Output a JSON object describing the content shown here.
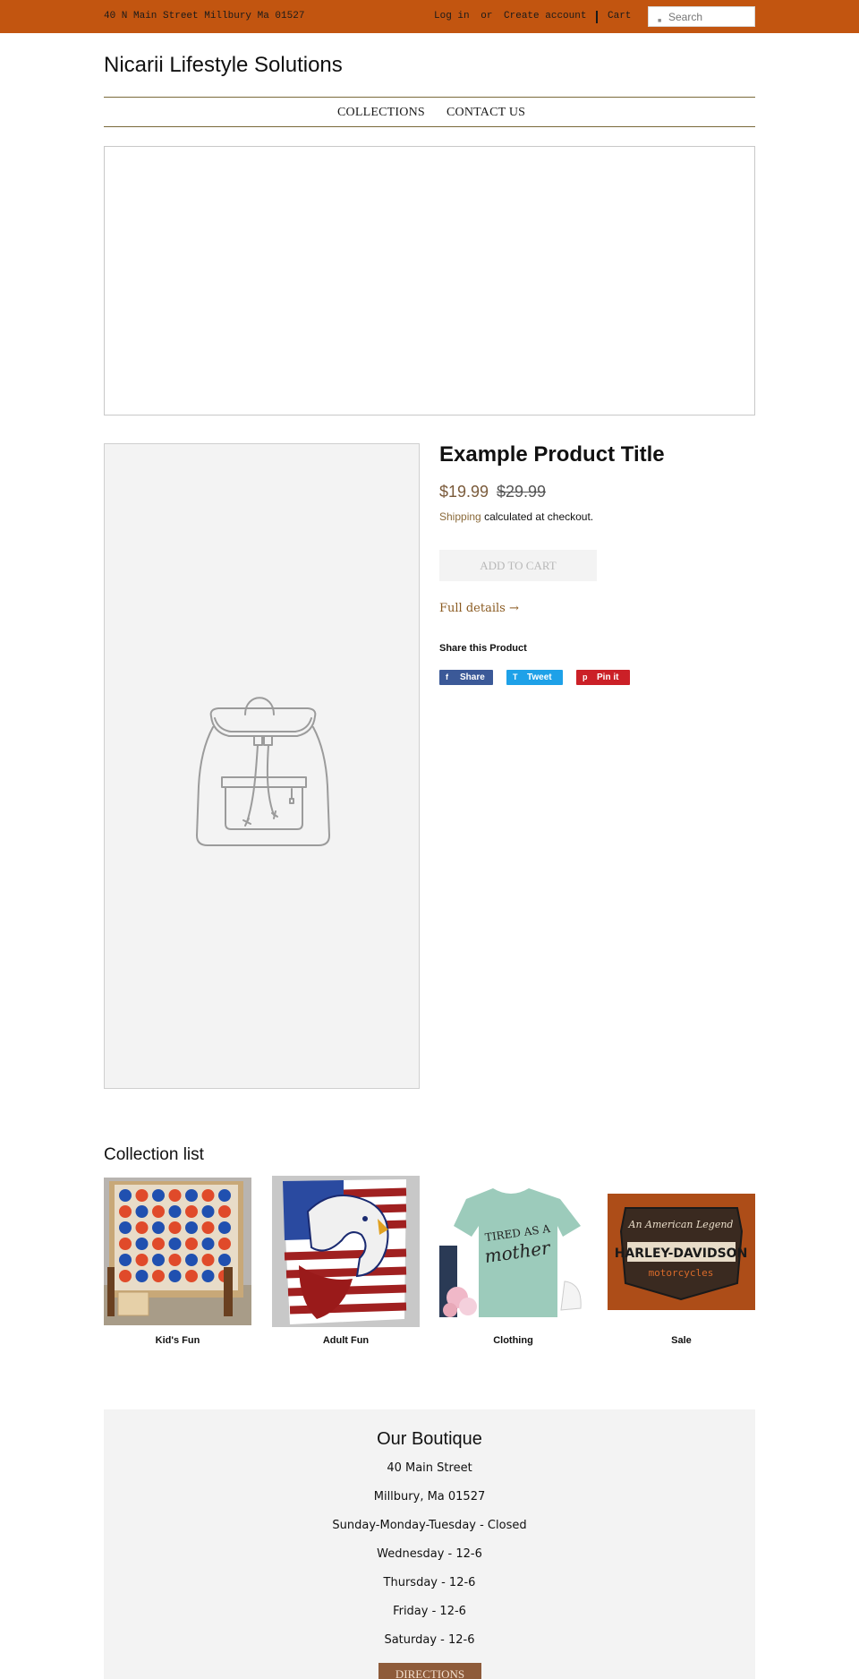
{
  "topbar": {
    "address": "40 N Main Street Millbury Ma 01527",
    "login_label": "Log in",
    "or_label": "or",
    "create_account_label": "Create account",
    "cart_label": "Cart",
    "search_placeholder": "Search",
    "background_color": "#c25510"
  },
  "logo": "Nicarii Lifestyle Solutions",
  "nav": {
    "items": [
      {
        "label": "COLLECTIONS"
      },
      {
        "label": "CONTACT US"
      }
    ]
  },
  "product": {
    "title": "Example Product Title",
    "price": "$19.99",
    "compare_price": "$29.99",
    "shipping_link": "Shipping",
    "shipping_text": "calculated at checkout.",
    "add_to_cart_label": "ADD TO CART",
    "full_details_label": "Full details →",
    "share_title": "Share this Product",
    "share_buttons": [
      {
        "glyph": "f",
        "label": "Share",
        "color": "#3b5998"
      },
      {
        "glyph": "T",
        "label": "Tweet",
        "color": "#1ea1e8"
      },
      {
        "glyph": "p",
        "label": "Pin it",
        "color": "#cb2027"
      }
    ],
    "image_icon": "backpack-placeholder-icon"
  },
  "collections": {
    "heading": "Collection list",
    "items": [
      {
        "label": "Kid's Fun"
      },
      {
        "label": "Adult Fun"
      },
      {
        "label": "Clothing"
      },
      {
        "label": "Sale"
      }
    ]
  },
  "boutique": {
    "title": "Our Boutique",
    "lines": [
      "40 Main Street",
      "Millbury, Ma 01527",
      "Sunday-Monday-Tuesday - Closed",
      "Wednesday - 12-6",
      "Thursday - 12-6",
      "Friday - 12-6",
      "Saturday - 12-6"
    ],
    "directions_label": "DIRECTIONS"
  }
}
